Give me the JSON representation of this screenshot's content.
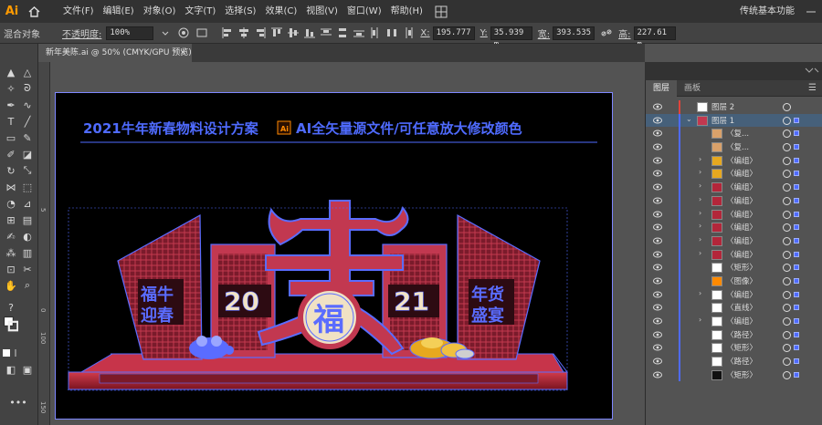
{
  "app": {
    "logo": "Ai",
    "workspace": "传统基本功能"
  },
  "menu": [
    "文件(F)",
    "编辑(E)",
    "对象(O)",
    "文字(T)",
    "选择(S)",
    "效果(C)",
    "视图(V)",
    "窗口(W)",
    "帮助(H)"
  ],
  "control": {
    "object_label": "混合对象",
    "opacity_label": "不透明度:",
    "opacity_value": "100%",
    "x_label": "X:",
    "x_value": "195.777",
    "y_label": "Y:",
    "y_value": "35.939 m",
    "w_label": "宽:",
    "w_value": "393.535",
    "h_label": "高:",
    "h_value": "227.61 m"
  },
  "document_tab": {
    "title": "新年美陈.ai @ 50% (CMYK/GPU 预览)",
    "close": "×"
  },
  "ruler": {
    "marks": [
      "5",
      "0",
      "100",
      "150"
    ]
  },
  "artwork": {
    "headline": "2021牛年新春物料设计方案",
    "ai_badge": "Ai",
    "subline": "AI全矢量源文件/可任意放大修改颜色",
    "left_panel_text": [
      "福牛",
      "迎春"
    ],
    "right_panel_text": [
      "年货",
      "盛宴"
    ],
    "year_left": "20",
    "year_right": "21",
    "center_char": "福",
    "accent_color": "#d13a48",
    "outline_color": "#5a6cff"
  },
  "layers_panel": {
    "tabs": [
      "图层",
      "画板"
    ],
    "menu_icon": "hamburger-icon",
    "rows": [
      {
        "name": "图层 2",
        "indent": 0,
        "arrow": "",
        "bar": "red",
        "selected": false,
        "thumb": "white"
      },
      {
        "name": "图层 1",
        "indent": 0,
        "arrow": "v",
        "bar": "blue",
        "selected": true,
        "thumb": "art"
      },
      {
        "name": "〈复...",
        "indent": 1,
        "arrow": "",
        "bar": "blue",
        "selected": false,
        "thumb": "pattern"
      },
      {
        "name": "〈复...",
        "indent": 1,
        "arrow": "",
        "bar": "blue",
        "selected": false,
        "thumb": "pattern"
      },
      {
        "name": "〈编组〉",
        "indent": 1,
        "arrow": ">",
        "bar": "blue",
        "selected": false,
        "thumb": "gold"
      },
      {
        "name": "〈编组〉",
        "indent": 1,
        "arrow": ">",
        "bar": "blue",
        "selected": false,
        "thumb": "gold"
      },
      {
        "name": "〈编组〉",
        "indent": 1,
        "arrow": ">",
        "bar": "blue",
        "selected": false,
        "thumb": "red"
      },
      {
        "name": "〈编组〉",
        "indent": 1,
        "arrow": ">",
        "bar": "blue",
        "selected": false,
        "thumb": "red"
      },
      {
        "name": "〈编组〉",
        "indent": 1,
        "arrow": ">",
        "bar": "blue",
        "selected": false,
        "thumb": "red"
      },
      {
        "name": "〈编组〉",
        "indent": 1,
        "arrow": ">",
        "bar": "blue",
        "selected": false,
        "thumb": "red"
      },
      {
        "name": "〈编组〉",
        "indent": 1,
        "arrow": ">",
        "bar": "blue",
        "selected": false,
        "thumb": "red"
      },
      {
        "name": "〈编组〉",
        "indent": 1,
        "arrow": ">",
        "bar": "blue",
        "selected": false,
        "thumb": "red"
      },
      {
        "name": "〈矩形〉",
        "indent": 1,
        "arrow": "",
        "bar": "blue",
        "selected": false,
        "thumb": "white"
      },
      {
        "name": "〈图像〉",
        "indent": 1,
        "arrow": "",
        "bar": "blue",
        "selected": false,
        "thumb": "ai"
      },
      {
        "name": "〈编组〉",
        "indent": 1,
        "arrow": ">",
        "bar": "blue",
        "selected": false,
        "thumb": "white"
      },
      {
        "name": "〈直线〉",
        "indent": 1,
        "arrow": "",
        "bar": "blue",
        "selected": false,
        "thumb": "white"
      },
      {
        "name": "〈编组〉",
        "indent": 1,
        "arrow": ">",
        "bar": "blue",
        "selected": false,
        "thumb": "white"
      },
      {
        "name": "〈路径〉",
        "indent": 1,
        "arrow": "",
        "bar": "blue",
        "selected": false,
        "thumb": "white"
      },
      {
        "name": "〈矩形〉",
        "indent": 1,
        "arrow": "",
        "bar": "blue",
        "selected": false,
        "thumb": "white"
      },
      {
        "name": "〈路径〉",
        "indent": 1,
        "arrow": "",
        "bar": "blue",
        "selected": false,
        "thumb": "white"
      },
      {
        "name": "〈矩形〉",
        "indent": 1,
        "arrow": "",
        "bar": "blue",
        "selected": false,
        "thumb": "black"
      }
    ]
  }
}
